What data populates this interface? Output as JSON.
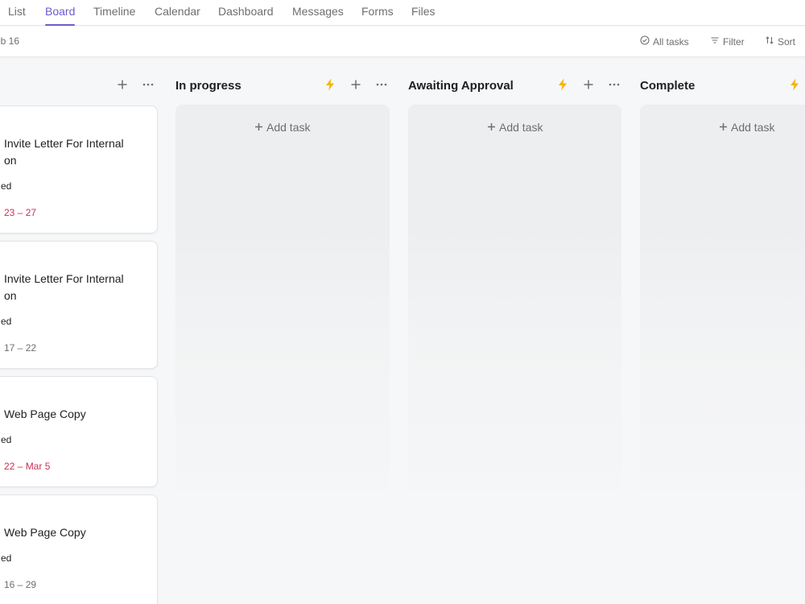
{
  "nav": {
    "tabs": [
      {
        "label": "List"
      },
      {
        "label": "Board"
      },
      {
        "label": "Timeline"
      },
      {
        "label": "Calendar"
      },
      {
        "label": "Dashboard"
      },
      {
        "label": "Messages"
      },
      {
        "label": "Forms"
      },
      {
        "label": "Files"
      }
    ],
    "active_tab": "Board",
    "accent_color": "#6d5bd0"
  },
  "toolbar": {
    "date_label": "eb 16",
    "all_tasks_label": "All tasks",
    "filter_label": "Filter",
    "sort_label": "Sort"
  },
  "columns": [
    {
      "title": "",
      "add_label": "",
      "cards": [
        {
          "title": "Invite Letter For Internal\non",
          "status": "ed",
          "date": "23 – 27",
          "date_overdue": true
        },
        {
          "title": "Invite Letter For Internal\non",
          "status": "ed",
          "date": "17 – 22",
          "date_overdue": false
        },
        {
          "title": "Web Page Copy",
          "status": "ed",
          "date": "22 – Mar 5",
          "date_overdue": true
        },
        {
          "title": "Web Page Copy",
          "status": "ed",
          "date": "16 – 29",
          "date_overdue": false
        }
      ]
    },
    {
      "title": "In progress",
      "add_label": "Add task"
    },
    {
      "title": "Awaiting Approval",
      "add_label": "Add task"
    },
    {
      "title": "Complete",
      "add_label": "Add task"
    }
  ],
  "icons": {
    "bolt": "lightning-bolt-icon",
    "plus": "plus-icon",
    "more": "more-dots-icon",
    "check_circle": "check-circle-icon",
    "filter": "filter-icon",
    "sort": "sort-icon"
  },
  "colors": {
    "bolt": "#f5b400",
    "overdue": "#c92f54"
  }
}
